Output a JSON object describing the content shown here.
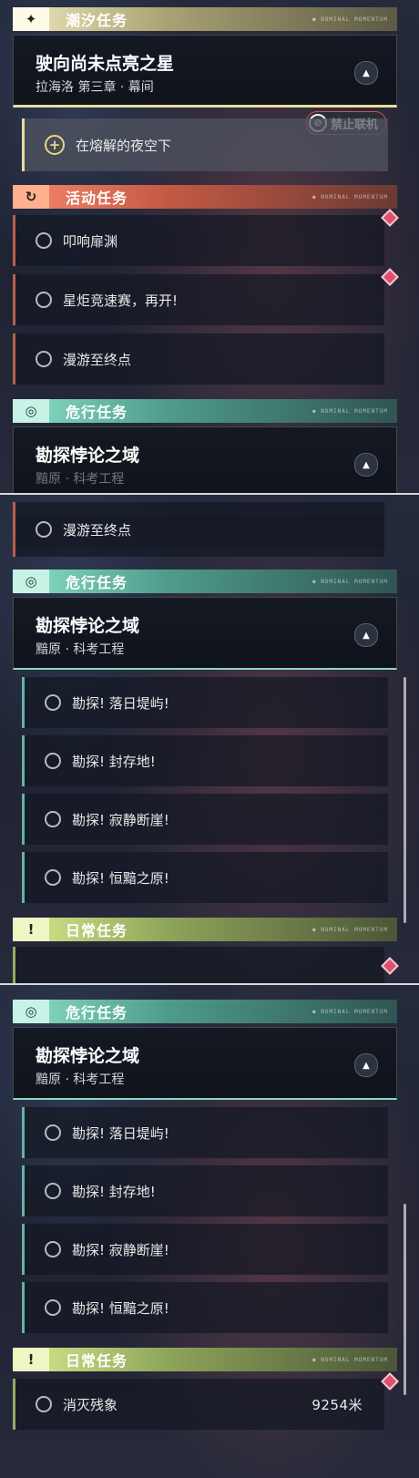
{
  "categories": {
    "tide": {
      "label": "潮汐任务",
      "icon": "✦",
      "tag": "● NOMINAL MOMENTUM"
    },
    "activity": {
      "label": "活动任务",
      "icon": "↻",
      "tag": "● NOMINAL MOMENTUM"
    },
    "danger": {
      "label": "危行任务",
      "icon": "◎",
      "tag": "● NOMINAL MOMENTUM"
    },
    "daily": {
      "label": "日常任务",
      "icon": "!",
      "tag": "● NOMINAL MOMENTUM"
    }
  },
  "tide_quest": {
    "title": "驶向尚未点亮之星",
    "subtitle": "拉海洛 第三章 · 幕间",
    "objective": "在熔解的夜空下",
    "online_status": "禁止联机"
  },
  "activity_quests": [
    "叩响扉渊",
    "星炬竞速赛，再开!",
    "漫游至终点"
  ],
  "danger_quest": {
    "title": "勘探悖论之域",
    "subtitle": "黯原 · 科考工程",
    "subtitle_partial": "黯原 · 科考工程",
    "objectives": [
      "勘探! 落日堤屿!",
      "勘探! 封存地!",
      "勘探! 寂静断崖!",
      "勘探! 恒黯之原!"
    ]
  },
  "daily_quest": {
    "label": "消灭残象",
    "distance": "9254米"
  },
  "colors": {
    "tide_accent": "#e6dd9e",
    "activity_accent": "#c45a45",
    "danger_accent": "#63b3a1",
    "daily_accent": "#94ab62",
    "gem": "#e0506c"
  }
}
